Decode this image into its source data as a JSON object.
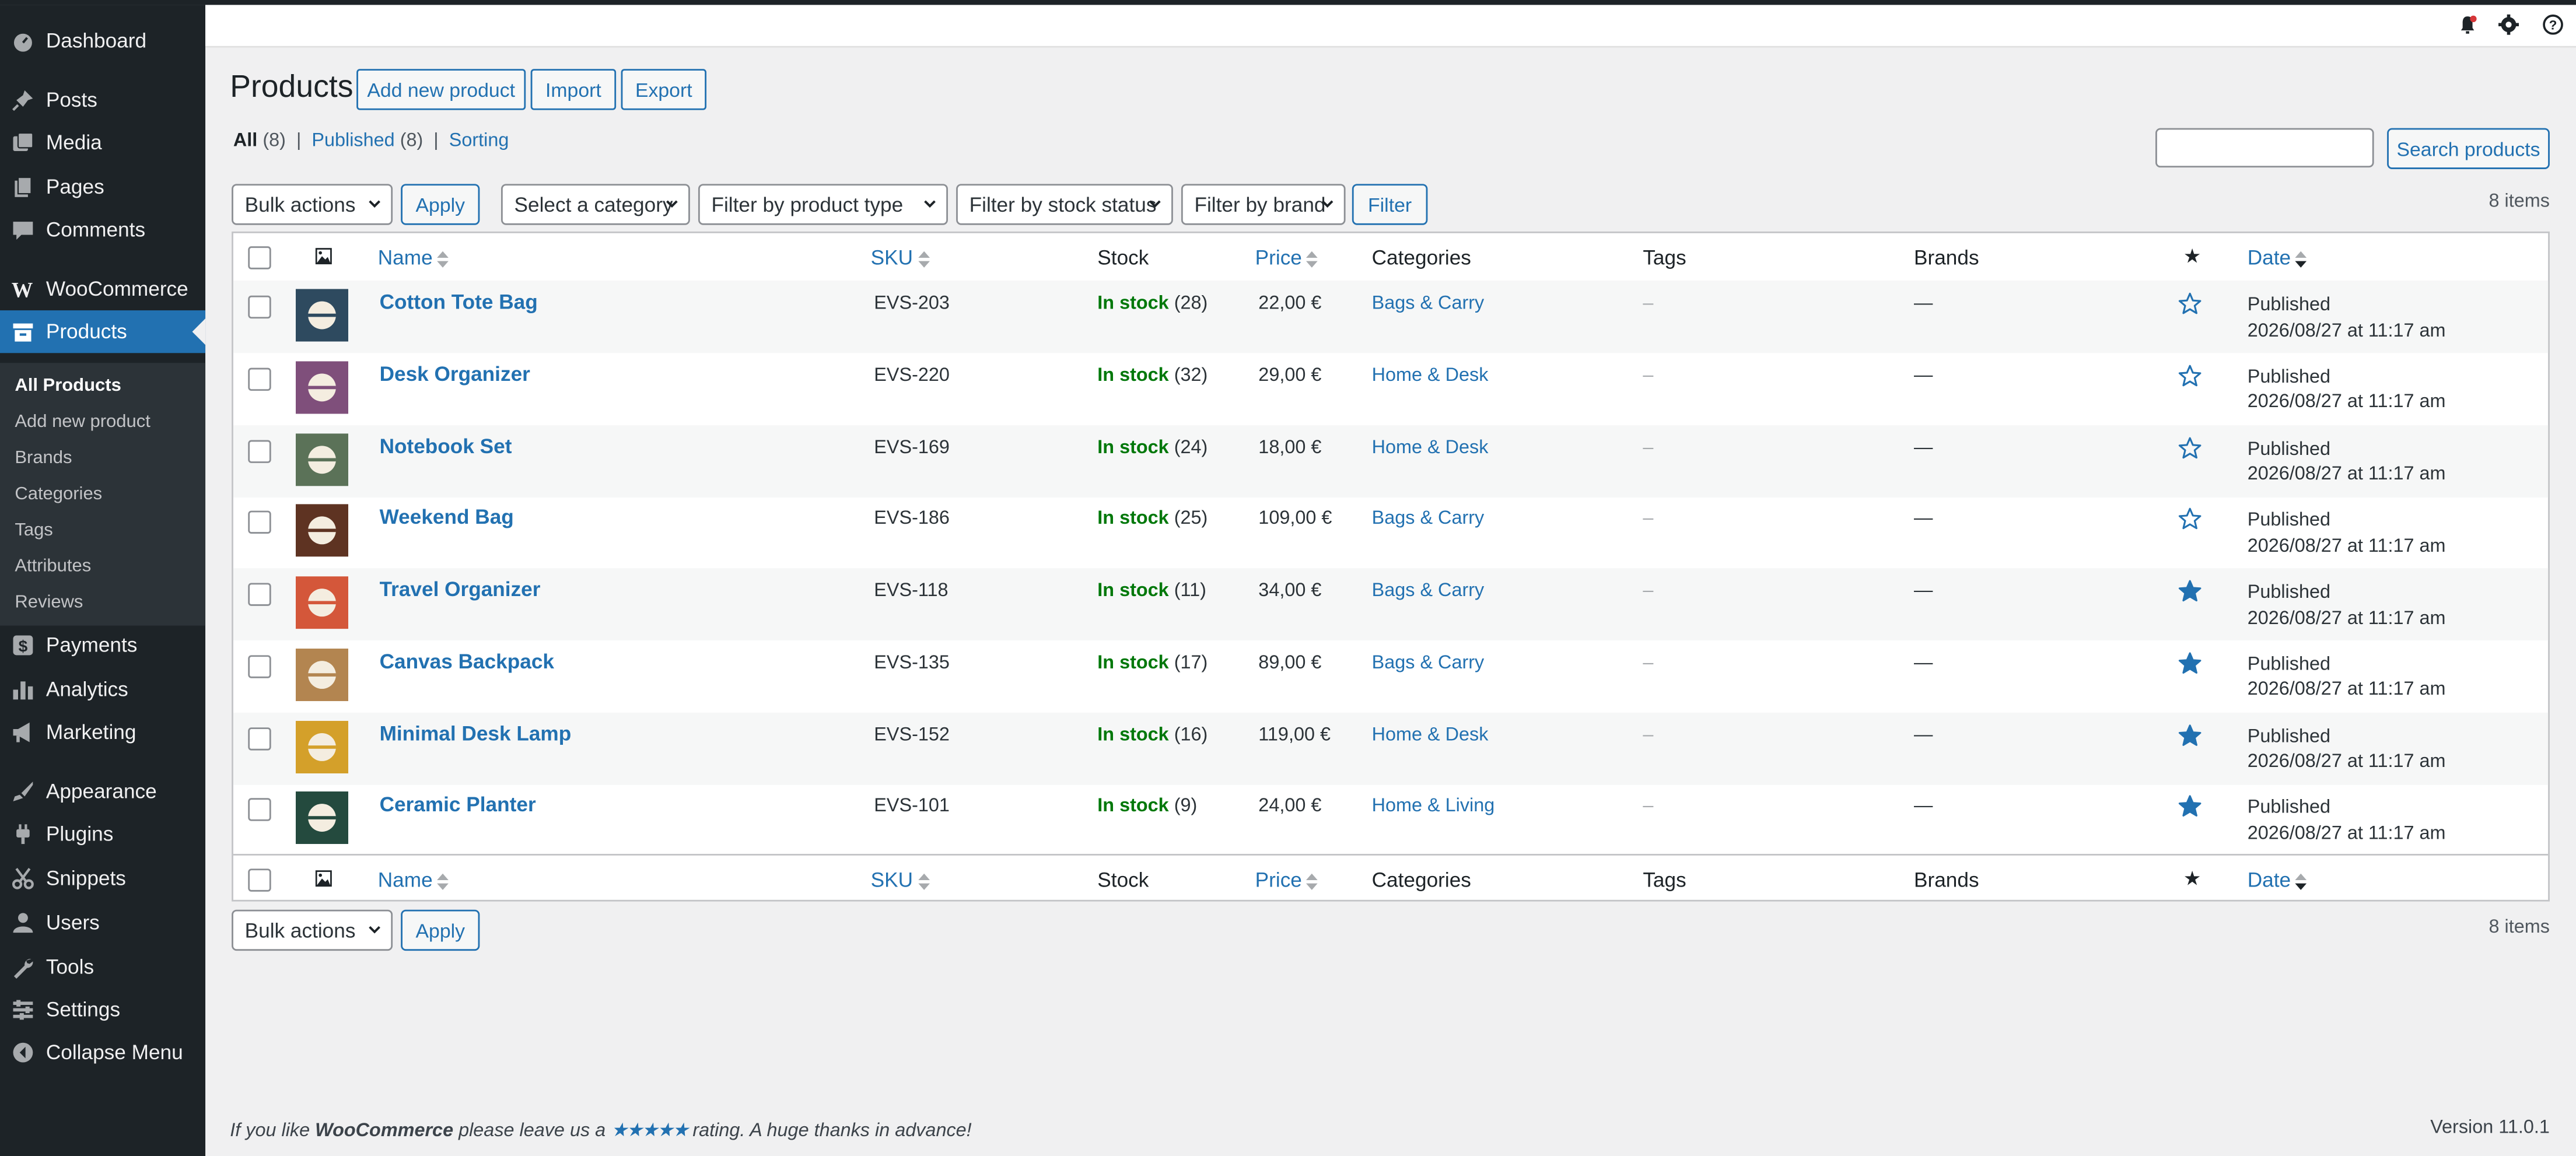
{
  "sidebar": {
    "items": [
      {
        "label": "Dashboard",
        "icon": "dashboard-icon"
      },
      {
        "label": "Posts",
        "icon": "pin-icon"
      },
      {
        "label": "Media",
        "icon": "media-icon"
      },
      {
        "label": "Pages",
        "icon": "pages-icon"
      },
      {
        "label": "Comments",
        "icon": "comment-icon"
      },
      {
        "label": "WooCommerce",
        "icon": "woo-icon"
      },
      {
        "label": "Products",
        "icon": "archive-icon"
      },
      {
        "label": "Payments",
        "icon": "dollar-icon"
      },
      {
        "label": "Analytics",
        "icon": "bar-chart-icon"
      },
      {
        "label": "Marketing",
        "icon": "megaphone-icon"
      },
      {
        "label": "Appearance",
        "icon": "brush-icon"
      },
      {
        "label": "Plugins",
        "icon": "plug-icon"
      },
      {
        "label": "Snippets",
        "icon": "scissors-icon"
      },
      {
        "label": "Users",
        "icon": "user-icon"
      },
      {
        "label": "Tools",
        "icon": "wrench-icon"
      },
      {
        "label": "Settings",
        "icon": "settings-icon"
      },
      {
        "label": "Collapse Menu",
        "icon": "collapse-icon"
      }
    ],
    "submenu": [
      "All Products",
      "Add new product",
      "Brands",
      "Categories",
      "Tags",
      "Attributes",
      "Reviews"
    ]
  },
  "adminbar": {
    "icons": [
      "notification-icon",
      "gear-icon",
      "help-icon"
    ]
  },
  "page": {
    "title": "Products",
    "buttons": {
      "add_new": "Add new product",
      "import": "Import",
      "export": "Export"
    },
    "views": {
      "all": "All",
      "all_count": "(8)",
      "published": "Published",
      "published_count": "(8)",
      "sorting": "Sorting",
      "sep": "|"
    },
    "search": {
      "button": "Search products",
      "value": ""
    },
    "filters": {
      "bulk_actions": "Bulk actions",
      "apply": "Apply",
      "category": "Select a category",
      "product_type": "Filter by product type",
      "stock_status": "Filter by stock status",
      "brand": "Filter by brand",
      "filter": "Filter"
    },
    "item_count": "8 items"
  },
  "table": {
    "columns": {
      "name": "Name",
      "sku": "SKU",
      "stock": "Stock",
      "price": "Price",
      "categories": "Categories",
      "tags": "Tags",
      "brands": "Brands",
      "featured": "★",
      "date": "Date"
    },
    "rows": [
      {
        "name": "Cotton Tote Bag",
        "sku": "EVS-203",
        "stock_status": "In stock",
        "stock_qty": "(28)",
        "price": "22,00 €",
        "category": "Bags & Carry",
        "tags": "–",
        "brands": "—",
        "featured": false,
        "status": "Published",
        "date": "2026/08/27 at 11:17 am",
        "color": "#2e4a5f"
      },
      {
        "name": "Desk Organizer",
        "sku": "EVS-220",
        "stock_status": "In stock",
        "stock_qty": "(32)",
        "price": "29,00 €",
        "category": "Home & Desk",
        "tags": "–",
        "brands": "—",
        "featured": false,
        "status": "Published",
        "date": "2026/08/27 at 11:17 am",
        "color": "#7f4f7b"
      },
      {
        "name": "Notebook Set",
        "sku": "EVS-169",
        "stock_status": "In stock",
        "stock_qty": "(24)",
        "price": "18,00 €",
        "category": "Home & Desk",
        "tags": "–",
        "brands": "—",
        "featured": false,
        "status": "Published",
        "date": "2026/08/27 at 11:17 am",
        "color": "#5b7258"
      },
      {
        "name": "Weekend Bag",
        "sku": "EVS-186",
        "stock_status": "In stock",
        "stock_qty": "(25)",
        "price": "109,00 €",
        "category": "Bags & Carry",
        "tags": "–",
        "brands": "—",
        "featured": false,
        "status": "Published",
        "date": "2026/08/27 at 11:17 am",
        "color": "#5e3322"
      },
      {
        "name": "Travel Organizer",
        "sku": "EVS-118",
        "stock_status": "In stock",
        "stock_qty": "(11)",
        "price": "34,00 €",
        "category": "Bags & Carry",
        "tags": "–",
        "brands": "—",
        "featured": true,
        "status": "Published",
        "date": "2026/08/27 at 11:17 am",
        "color": "#d4573a"
      },
      {
        "name": "Canvas Backpack",
        "sku": "EVS-135",
        "stock_status": "In stock",
        "stock_qty": "(17)",
        "price": "89,00 €",
        "category": "Bags & Carry",
        "tags": "–",
        "brands": "—",
        "featured": true,
        "status": "Published",
        "date": "2026/08/27 at 11:17 am",
        "color": "#b38550"
      },
      {
        "name": "Minimal Desk Lamp",
        "sku": "EVS-152",
        "stock_status": "In stock",
        "stock_qty": "(16)",
        "price": "119,00 €",
        "category": "Home & Desk",
        "tags": "–",
        "brands": "—",
        "featured": true,
        "status": "Published",
        "date": "2026/08/27 at 11:17 am",
        "color": "#d4a02a"
      },
      {
        "name": "Ceramic Planter",
        "sku": "EVS-101",
        "stock_status": "In stock",
        "stock_qty": "(9)",
        "price": "24,00 €",
        "category": "Home & Living",
        "tags": "–",
        "brands": "—",
        "featured": true,
        "status": "Published",
        "date": "2026/08/27 at 11:17 am",
        "color": "#244a3e"
      }
    ]
  },
  "footer": {
    "prefix": "If you like ",
    "brand": "WooCommerce",
    "middle": " please leave us a ",
    "stars": "★★★★★",
    "suffix": " rating. A huge thanks in advance!",
    "version": "Version 11.0.1"
  },
  "colors": {
    "accent": "#2271b1",
    "sidebar": "#1d2327",
    "in_stock": "#00780a"
  }
}
